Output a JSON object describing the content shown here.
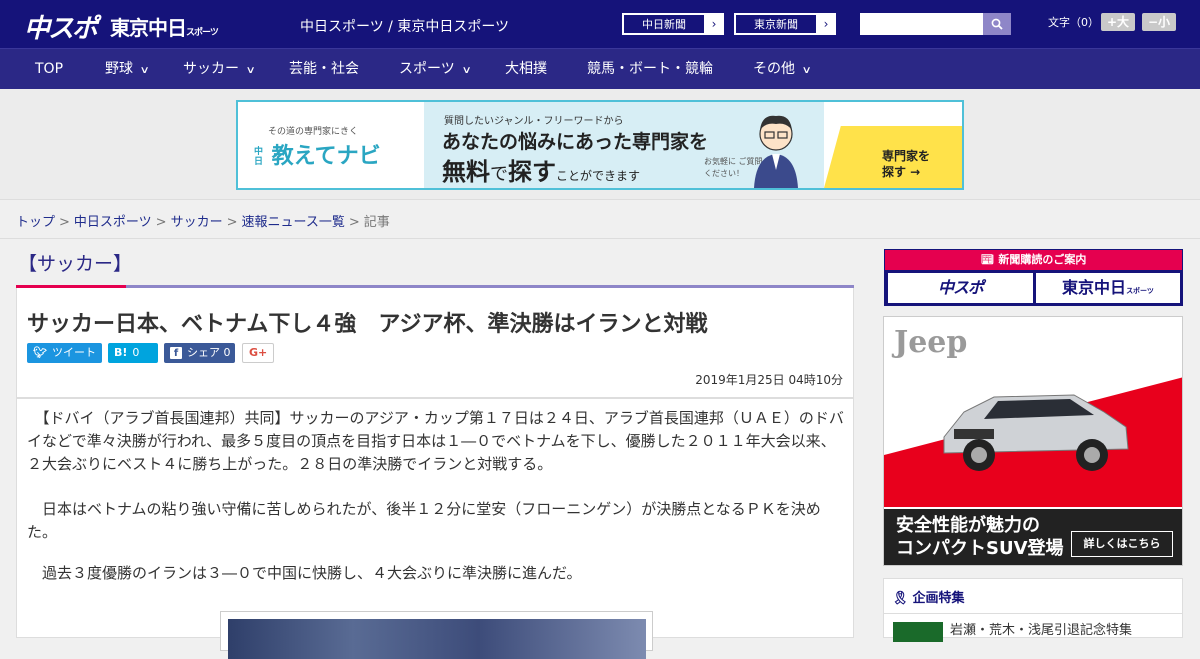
{
  "header": {
    "logo_chunichi": "中スポ",
    "logo_tokyo": "東京中日",
    "logo_tokyo_sub": "スポーツ",
    "site_title": "中日スポーツ / 東京中日スポーツ",
    "links": [
      {
        "label": "中日新聞",
        "arrow": "›"
      },
      {
        "label": "東京新聞",
        "arrow": "›"
      }
    ],
    "search_placeholder": "",
    "search_icon": "search-icon",
    "font_size_label": "文字（0）",
    "font_larger": "+大",
    "font_smaller": "−小"
  },
  "nav": [
    {
      "label": "TOP",
      "has_menu": false
    },
    {
      "label": "野球",
      "has_menu": true
    },
    {
      "label": "サッカー",
      "has_menu": true
    },
    {
      "label": "芸能・社会",
      "has_menu": false
    },
    {
      "label": "スポーツ",
      "has_menu": true
    },
    {
      "label": "大相撲",
      "has_menu": false
    },
    {
      "label": "競馬・ボート・競輪",
      "has_menu": false
    },
    {
      "label": "その他",
      "has_menu": true
    }
  ],
  "banner_ad": {
    "tagline": "その道の専門家にきく",
    "brand_prefix": "中日",
    "brand": "教えてナビ",
    "line1": "質問したいジャンル・フリーワードから",
    "line2": "あなたの悩みにあった専門家を",
    "line3a": "無料",
    "line3b": "で",
    "line3c": "探す",
    "line3d": "ことができます",
    "line4": "お気軽に ご質問ください！",
    "cta": "専門家を 探す →"
  },
  "breadcrumb": {
    "items": [
      "トップ",
      "中日スポーツ",
      "サッカー",
      "速報ニュース一覧"
    ],
    "current": "記事",
    "separator": ">"
  },
  "article": {
    "category": "【サッカー】",
    "title": "サッカー日本、ベトナム下し４強　アジア杯、準決勝はイランと対戦",
    "share": {
      "tweet": "ツイート",
      "hatena_count": "0",
      "facebook": "シェア",
      "facebook_count": "0",
      "gplus": "G+"
    },
    "date": "2019年1月25日 04時10分",
    "paragraphs": [
      "　【ドバイ（アラブ首長国連邦）共同】サッカーのアジア・カップ第１７日は２４日、アラブ首長国連邦（ＵＡＥ）のドバイなどで準々決勝が行われ、最多５度目の頂点を目指す日本は１―０でベトナムを下し、優勝した２０１１年大会以来、２大会ぶりにベスト４に勝ち上がった。２８日の準決勝でイランと対戦する。",
      "　日本はベトナムの粘り強い守備に苦しめられたが、後半１２分に堂安（フローニンゲン）が決勝点となるＰＫを決めた。",
      "　過去３度優勝のイランは３―０で中国に快勝し、４大会ぶりに準決勝に進んだ。"
    ]
  },
  "sidebar": {
    "subscribe_head": "新聞購読のご案内",
    "subscribe_a": "中スポ",
    "subscribe_b": "東京中日",
    "subscribe_b_sub": "スポーツ",
    "ad": {
      "brand": "Jeep",
      "headline1": "安全性能が魅力の",
      "headline2": "コンパクトSUV登場",
      "cta": "詳しくはこちら"
    },
    "feature_head": "企画特集",
    "feature_item": "岩瀬・荒木・浅尾引退記念特集"
  },
  "colors": {
    "header_bg": "#15137a",
    "nav_bg": "#2b2886",
    "accent_red": "#e5004f",
    "link": "#1f2c8c",
    "twitter": "#1b95e0",
    "hatena": "#00a4de",
    "facebook": "#3b5998"
  }
}
